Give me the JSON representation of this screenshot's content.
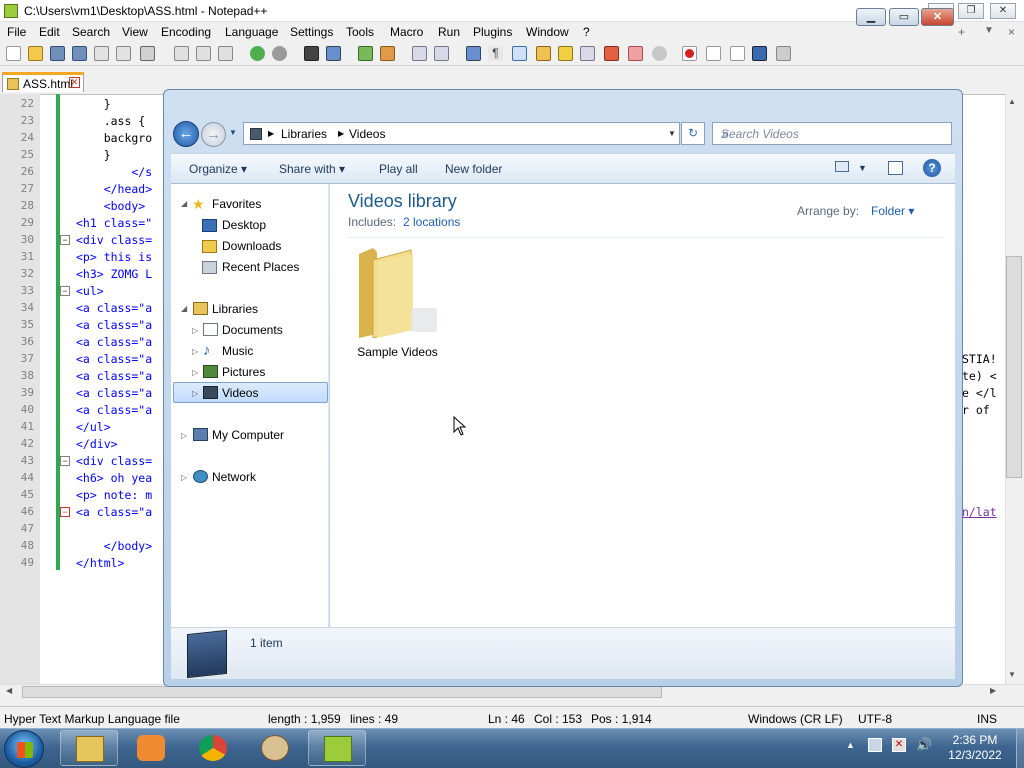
{
  "notepadpp": {
    "title": "C:\\Users\\vm1\\Desktop\\ASS.html - Notepad++",
    "menu": [
      "File",
      "Edit",
      "Search",
      "View",
      "Encoding",
      "Language",
      "Settings",
      "Tools",
      "Macro",
      "Run",
      "Plugins",
      "Window",
      "?"
    ],
    "tab_label": "ASS.html",
    "menu_right": [
      "+",
      "▼",
      "×"
    ],
    "code_lines": [
      {
        "n": "22",
        "t": "    }"
      },
      {
        "n": "23",
        "t": "    .ass {"
      },
      {
        "n": "24",
        "t": "    backgro"
      },
      {
        "n": "25",
        "t": "    }"
      },
      {
        "n": "26",
        "t": "        </s"
      },
      {
        "n": "27",
        "t": "    </head>"
      },
      {
        "n": "28",
        "t": "    <body>"
      },
      {
        "n": "29",
        "t": "<h1 class=\""
      },
      {
        "n": "30",
        "t": "<div class="
      },
      {
        "n": "31",
        "t": "<p> this is"
      },
      {
        "n": "32",
        "t": "<h3> ZOMG L"
      },
      {
        "n": "33",
        "t": "<ul>"
      },
      {
        "n": "34",
        "t": "<a class=\"a"
      },
      {
        "n": "35",
        "t": "<a class=\"a"
      },
      {
        "n": "36",
        "t": "<a class=\"a"
      },
      {
        "n": "37",
        "t": "<a class=\"a"
      },
      {
        "n": "38",
        "t": "<a class=\"a"
      },
      {
        "n": "39",
        "t": "<a class=\"a"
      },
      {
        "n": "40",
        "t": "<a class=\"a"
      },
      {
        "n": "41",
        "t": "</ul>"
      },
      {
        "n": "42",
        "t": "</div>"
      },
      {
        "n": "43",
        "t": "<div class="
      },
      {
        "n": "44",
        "t": "<h6> oh yea"
      },
      {
        "n": "45",
        "t": "<p> note: m"
      },
      {
        "n": "46",
        "t": "<a class=\"a"
      },
      {
        "n": "47",
        "t": ""
      },
      {
        "n": "48",
        "t": "    </body>"
      },
      {
        "n": "49",
        "t": "</html>"
      }
    ],
    "right_fragments": [
      "STIA!",
      "te) <",
      "e </l",
      "r of",
      "n/lat"
    ],
    "status": {
      "filetype": "Hyper Text Markup Language file",
      "length": "length : 1,959",
      "lines": "lines : 49",
      "ln": "Ln : 46",
      "col": "Col : 153",
      "pos": "Pos : 1,914",
      "eol": "Windows (CR LF)",
      "encoding": "UTF-8",
      "mode": "INS"
    }
  },
  "explorer": {
    "breadcrumb": [
      "Libraries",
      "Videos"
    ],
    "search_placeholder": "Search Videos",
    "commands": [
      "Organize",
      "Share with",
      "Play all",
      "New folder"
    ],
    "nav": {
      "favorites": "Favorites",
      "fav_items": [
        "Desktop",
        "Downloads",
        "Recent Places"
      ],
      "libraries": "Libraries",
      "lib_items": [
        "Documents",
        "Music",
        "Pictures",
        "Videos"
      ],
      "computer": "My Computer",
      "network": "Network"
    },
    "library_title": "Videos library",
    "includes_label": "Includes:",
    "includes_link": "2 locations",
    "arrange_label": "Arrange by:",
    "arrange_value": "Folder",
    "items": [
      {
        "name": "Sample Videos"
      }
    ],
    "item_count": "1 item"
  },
  "taskbar": {
    "time": "2:36 PM",
    "date": "12/3/2022"
  }
}
